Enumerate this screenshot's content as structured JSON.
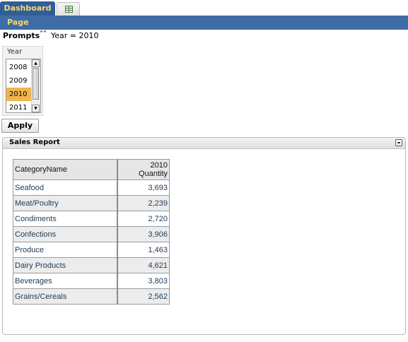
{
  "tabs": {
    "active_label": "Dashboard",
    "second_icon": "table-icon"
  },
  "page_bar": {
    "label": "Page"
  },
  "prompts": {
    "label": "Prompts",
    "collapse_icon": "double-chevron-up-icon",
    "summary": "Year = 2010"
  },
  "year_prompt": {
    "label": "Year",
    "options": [
      "2008",
      "2009",
      "2010",
      "2011"
    ],
    "selected": "2010"
  },
  "apply_button": {
    "label": "Apply"
  },
  "report": {
    "title": "Sales Report",
    "columns": [
      "CategoryName",
      "2010 Quantity"
    ],
    "rows": [
      {
        "name": "Seafood",
        "qty": "3,693"
      },
      {
        "name": "Meat/Poultry",
        "qty": "2,239"
      },
      {
        "name": "Condiments",
        "qty": "2,720"
      },
      {
        "name": "Confections",
        "qty": "3,906"
      },
      {
        "name": "Produce",
        "qty": "1,463"
      },
      {
        "name": "Dairy Products",
        "qty": "4,621"
      },
      {
        "name": "Beverages",
        "qty": "3,803"
      },
      {
        "name": "Grains/Cereals",
        "qty": "2,562"
      }
    ]
  },
  "colors": {
    "tab_active": "#2e5f99",
    "page_bar": "#3e6da6",
    "tab_text": "#ffd76a",
    "selected_year": "#f2b44e"
  }
}
